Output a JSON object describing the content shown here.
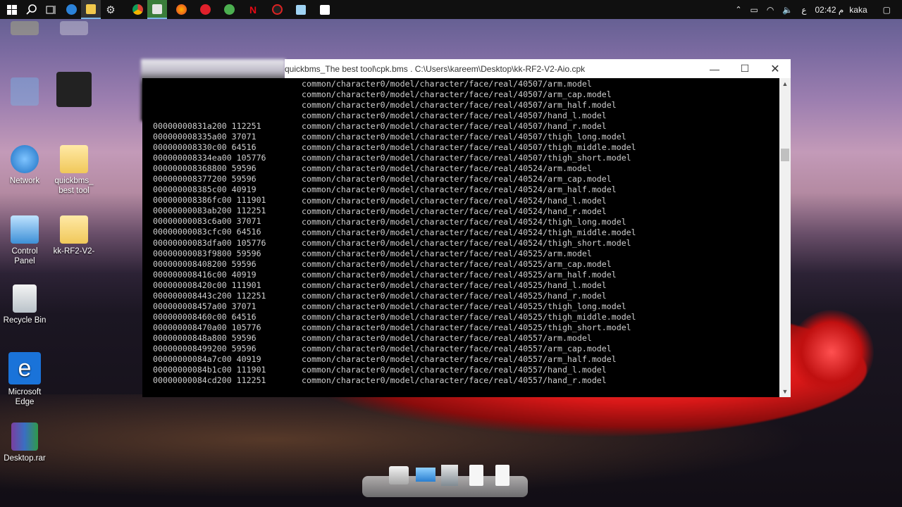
{
  "taskbar": {
    "icons": [
      "windows-start-icon",
      "search-icon",
      "task-view-icon",
      "edge-icon",
      "file-explorer-icon",
      "settings-icon",
      "chrome-icon",
      "app-icon",
      "firefox-icon",
      "opera-icon",
      "globe-icon",
      "netflix-icon",
      "record-icon",
      "notes-icon",
      "media-icon"
    ],
    "tray": {
      "language": "ع",
      "time": "02:42 م",
      "user": "kaka"
    }
  },
  "desktop": {
    "icons": [
      {
        "label": "Network"
      },
      {
        "label": "quickbms_\nbest tool"
      },
      {
        "label": "Control\nPanel"
      },
      {
        "label": "kk-RF2-V2-"
      },
      {
        "label": "Recycle Bin"
      },
      {
        "label": "Microsoft\nEdge"
      },
      {
        "label": "Desktop.rar"
      }
    ]
  },
  "console": {
    "title": "quickbms_The best tool\\cpk.bms . C:\\Users\\kareem\\Desktop\\kk-RF2-V2-Aio.cpk",
    "rows": [
      {
        "offset": "",
        "path": "common/character0/model/character/face/real/40507/arm.model"
      },
      {
        "offset": "",
        "path": "common/character0/model/character/face/real/40507/arm_cap.model"
      },
      {
        "offset": "",
        "path": "common/character0/model/character/face/real/40507/arm_half.model"
      },
      {
        "offset": "",
        "path": "common/character0/model/character/face/real/40507/hand_l.model"
      },
      {
        "offset": "00000000831a200 112251",
        "path": "common/character0/model/character/face/real/40507/hand_r.model"
      },
      {
        "offset": "000000008335a00 37071",
        "path": "common/character0/model/character/face/real/40507/thigh_long.model"
      },
      {
        "offset": "000000008330c00 64516",
        "path": "common/character0/model/character/face/real/40507/thigh_middle.model"
      },
      {
        "offset": "000000008334ea00 105776",
        "path": "common/character0/model/character/face/real/40507/thigh_short.model"
      },
      {
        "offset": "000000008368800 59596",
        "path": "common/character0/model/character/face/real/40524/arm.model"
      },
      {
        "offset": "000000008377200 59596",
        "path": "common/character0/model/character/face/real/40524/arm_cap.model"
      },
      {
        "offset": "000000008385c00 40919",
        "path": "common/character0/model/character/face/real/40524/arm_half.model"
      },
      {
        "offset": "000000008386fc00 111901",
        "path": "common/character0/model/character/face/real/40524/hand_l.model"
      },
      {
        "offset": "00000000083ab200 112251",
        "path": "common/character0/model/character/face/real/40524/hand_r.model"
      },
      {
        "offset": "00000000083c6a00 37071",
        "path": "common/character0/model/character/face/real/40524/thigh_long.model"
      },
      {
        "offset": "00000000083cfc00 64516",
        "path": "common/character0/model/character/face/real/40524/thigh_middle.model"
      },
      {
        "offset": "00000000083dfa00 105776",
        "path": "common/character0/model/character/face/real/40524/thigh_short.model"
      },
      {
        "offset": "00000000083f9800 59596",
        "path": "common/character0/model/character/face/real/40525/arm.model"
      },
      {
        "offset": "000000008408200 59596",
        "path": "common/character0/model/character/face/real/40525/arm_cap.model"
      },
      {
        "offset": "000000008416c00 40919",
        "path": "common/character0/model/character/face/real/40525/arm_half.model"
      },
      {
        "offset": "000000008420c00 111901",
        "path": "common/character0/model/character/face/real/40525/hand_l.model"
      },
      {
        "offset": "000000008443c200 112251",
        "path": "common/character0/model/character/face/real/40525/hand_r.model"
      },
      {
        "offset": "000000008457a00 37071",
        "path": "common/character0/model/character/face/real/40525/thigh_long.model"
      },
      {
        "offset": "000000008460c00 64516",
        "path": "common/character0/model/character/face/real/40525/thigh_middle.model"
      },
      {
        "offset": "000000008470a00 105776",
        "path": "common/character0/model/character/face/real/40525/thigh_short.model"
      },
      {
        "offset": "00000000848a800 59596",
        "path": "common/character0/model/character/face/real/40557/arm.model"
      },
      {
        "offset": "000000008499200 59596",
        "path": "common/character0/model/character/face/real/40557/arm_cap.model"
      },
      {
        "offset": "00000000084a7c00 40919",
        "path": "common/character0/model/character/face/real/40557/arm_half.model"
      },
      {
        "offset": "00000000084b1c00 111901",
        "path": "common/character0/model/character/face/real/40557/hand_l.model"
      },
      {
        "offset": "00000000084cd200 112251",
        "path": "common/character0/model/character/face/real/40557/hand_r.model"
      }
    ]
  }
}
